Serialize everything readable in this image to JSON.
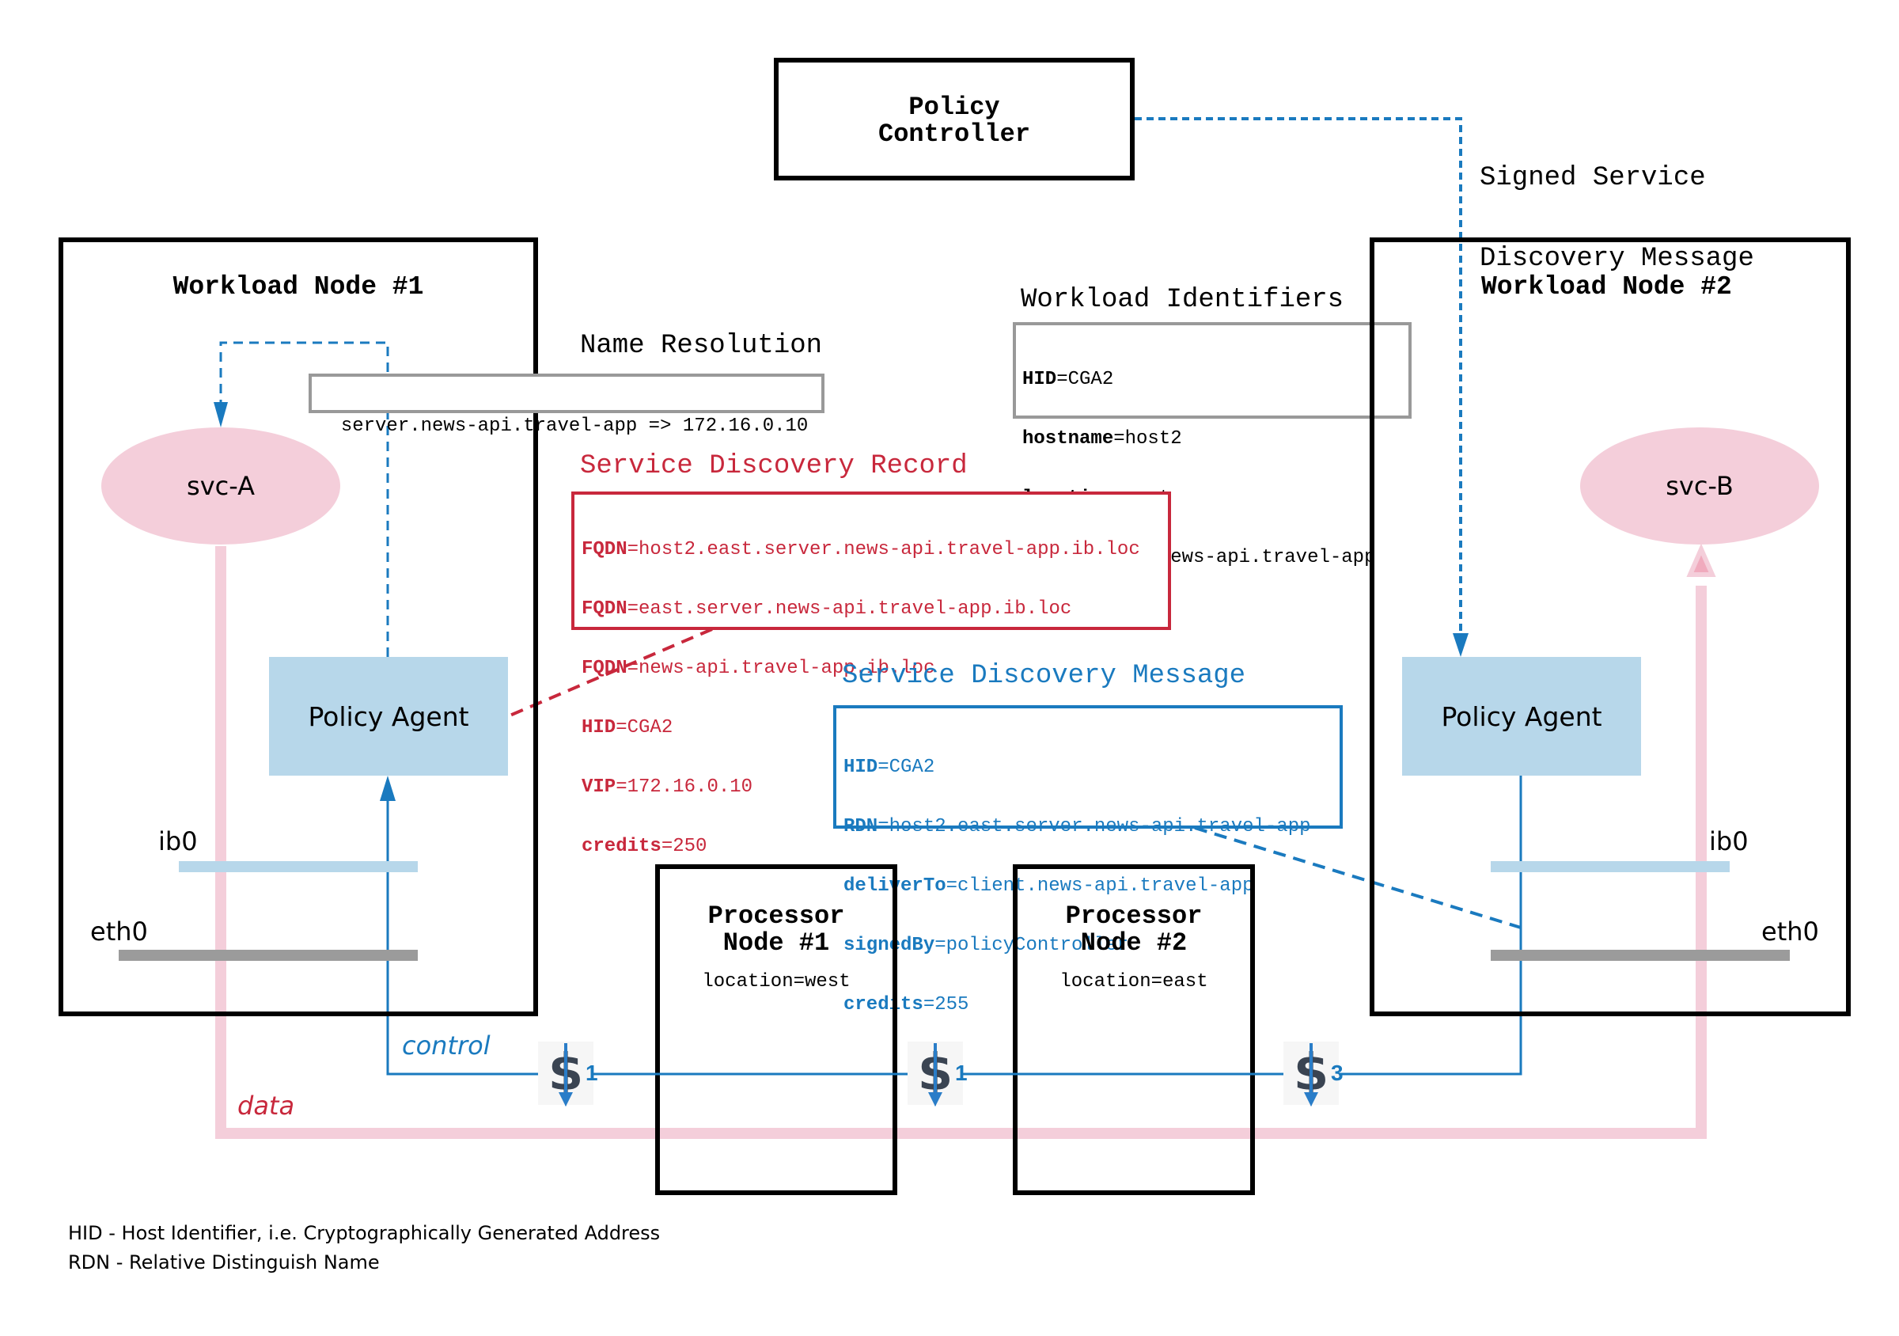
{
  "policy_controller": {
    "title_line1": "Policy",
    "title_line2": "Controller"
  },
  "signed_message_label": {
    "line1": "Signed Service",
    "line2": "Discovery Message"
  },
  "workload_node_1": {
    "title": "Workload Node #1",
    "service": "svc-A",
    "agent": "Policy Agent",
    "ib_label": "ib0",
    "eth_label": "eth0"
  },
  "workload_node_2": {
    "title": "Workload Node #2",
    "service": "svc-B",
    "agent": "Policy Agent",
    "ib_label": "ib0",
    "eth_label": "eth0"
  },
  "name_resolution": {
    "title": "Name Resolution",
    "text": "server.news-api.travel-app => 172.16.0.10"
  },
  "workload_identifiers": {
    "title": "Workload Identifiers",
    "rows": [
      {
        "key": "HID",
        "value": "CGA2"
      },
      {
        "key": "hostname",
        "value": "host2"
      },
      {
        "key": "location",
        "value": "east"
      },
      {
        "key": "role",
        "value": "server.news-api.travel-app"
      }
    ]
  },
  "service_discovery_record": {
    "title": "Service Discovery Record",
    "color": "#c8283c",
    "rows": [
      {
        "key": "FQDN",
        "value": "host2.east.server.news-api.travel-app.ib.loc"
      },
      {
        "key": "FQDN",
        "value": "east.server.news-api.travel-app.ib.loc"
      },
      {
        "key": "FQDN",
        "value": "news-api.travel-app.ib.loc"
      },
      {
        "key": "HID",
        "value": "CGA2"
      },
      {
        "key": "VIP",
        "value": "172.16.0.10"
      },
      {
        "key": "credits",
        "value": "250"
      }
    ]
  },
  "service_discovery_message": {
    "title": "Service Discovery Message",
    "color": "#1a7abf",
    "rows": [
      {
        "key": "HID",
        "value": "CGA2"
      },
      {
        "key": "RDN",
        "value": "host2.east.server.news-api.travel-app"
      },
      {
        "key": "deliverTo",
        "value": "client.news-api.travel-app"
      },
      {
        "key": "signedBy",
        "value": "policyController"
      },
      {
        "key": "credits",
        "value": "255"
      }
    ]
  },
  "processor_node_1": {
    "title_line1": "Processor",
    "title_line2": "Node #1",
    "location": "location=west"
  },
  "processor_node_2": {
    "title_line1": "Processor",
    "title_line2": "Node #2",
    "location": "location=east"
  },
  "flows": {
    "control_label": "control",
    "data_label": "data",
    "control_color": "#1a7abf",
    "data_color": "#f4ceda"
  },
  "credit_costs": [
    {
      "icon": "dollar-icon",
      "value": "1"
    },
    {
      "icon": "dollar-icon",
      "value": "1"
    },
    {
      "icon": "dollar-icon",
      "value": "3"
    }
  ],
  "legend": {
    "line1": "HID - Host Identifier, i.e. Cryptographically Generated Address",
    "line2": "RDN - Relative Distinguish Name"
  }
}
